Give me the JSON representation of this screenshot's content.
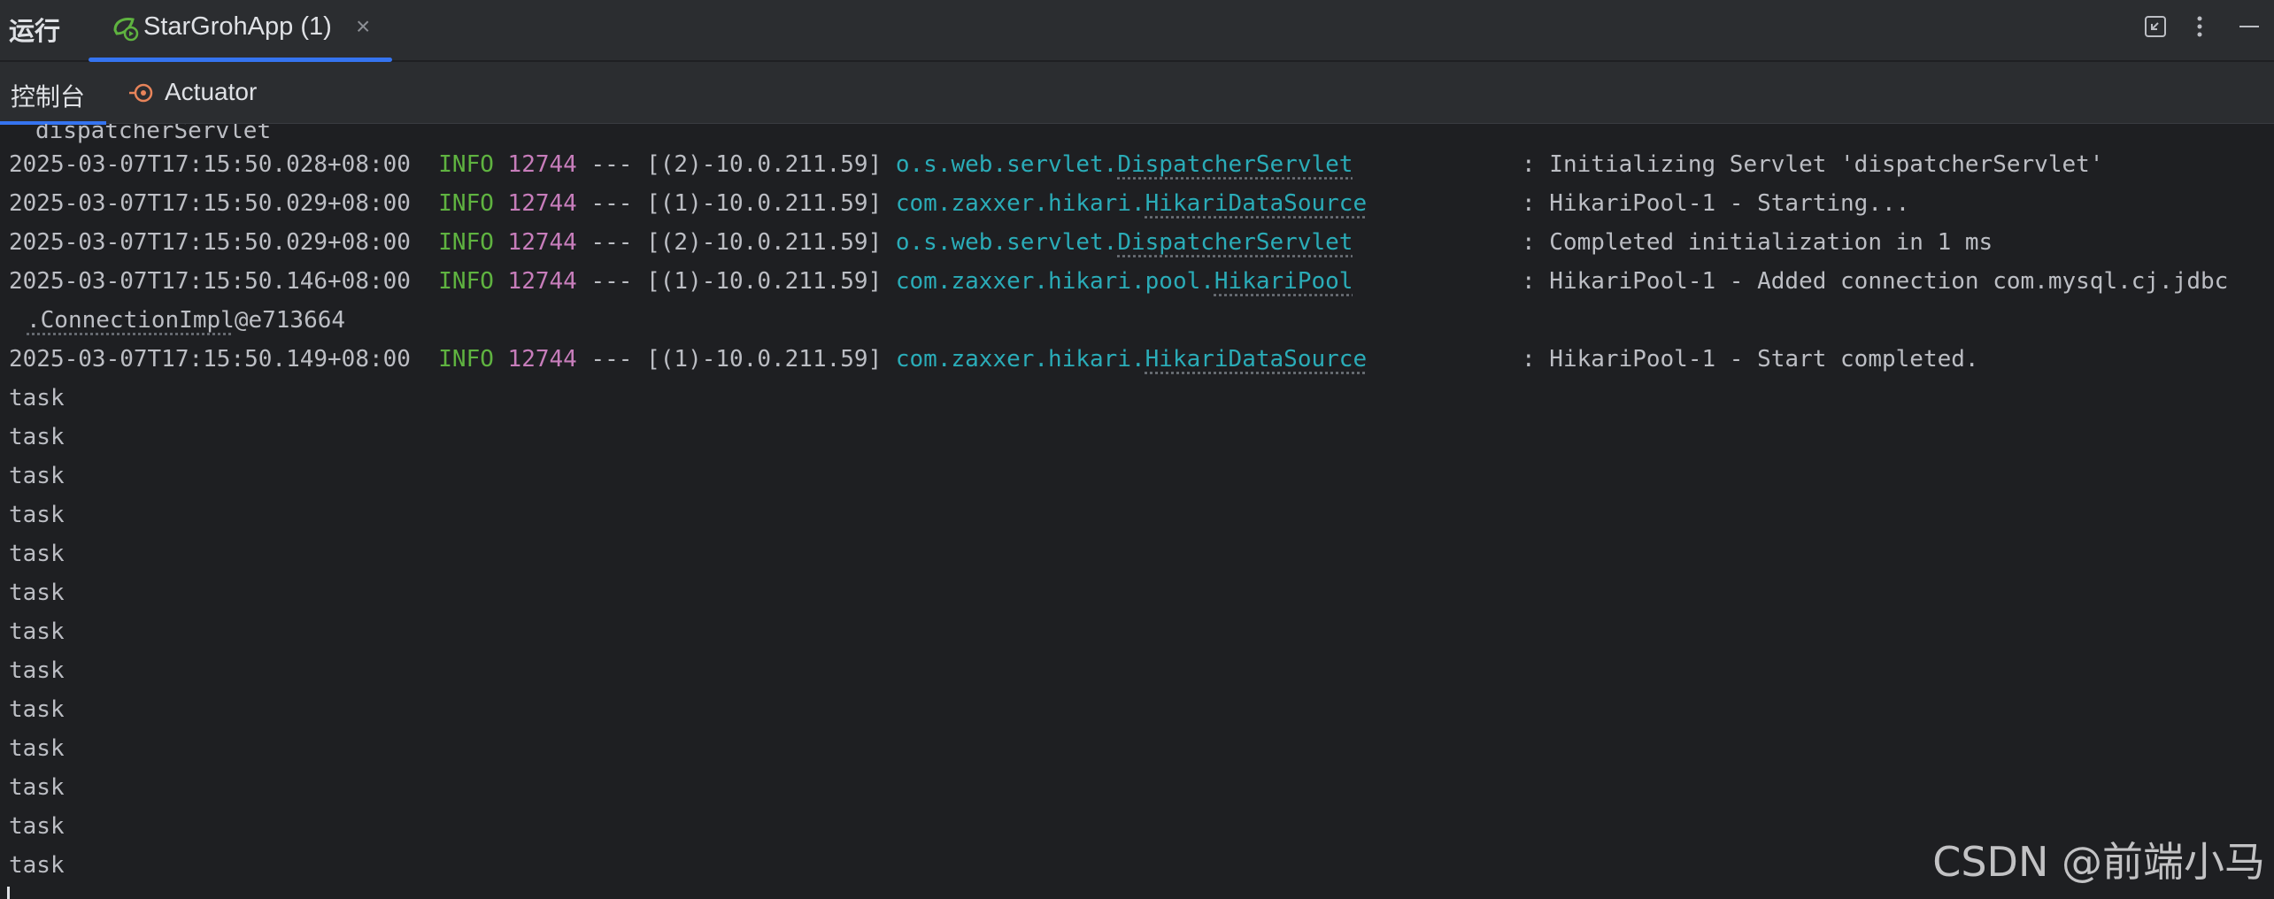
{
  "header": {
    "run_label": "运行",
    "tab_label": "StarGrohApp (1)",
    "tab_close": "×",
    "accent": "#3574f0"
  },
  "subtabs": [
    {
      "label": "控制台",
      "icon": "console"
    },
    {
      "label": "Actuator",
      "icon": "actuator-icon"
    }
  ],
  "console": {
    "truncated_prev": "dispatcherServlet",
    "logs": [
      {
        "ts": "2025-03-07T17:15:50.028+08:00",
        "level": "INFO",
        "pid": "12744",
        "sep": "---",
        "thread": "[(2)-10.0.211.59]",
        "logger_pkg": "o.s.web.servlet.",
        "logger_cls": "DispatcherServlet",
        "message": ": Initializing Servlet 'dispatcherServlet'"
      },
      {
        "ts": "2025-03-07T17:15:50.029+08:00",
        "level": "INFO",
        "pid": "12744",
        "sep": "---",
        "thread": "[(1)-10.0.211.59]",
        "logger_pkg": "com.zaxxer.hikari.",
        "logger_cls": "HikariDataSource",
        "message": ": HikariPool-1 - Starting..."
      },
      {
        "ts": "2025-03-07T17:15:50.029+08:00",
        "level": "INFO",
        "pid": "12744",
        "sep": "---",
        "thread": "[(2)-10.0.211.59]",
        "logger_pkg": "o.s.web.servlet.",
        "logger_cls": "DispatcherServlet",
        "message": ": Completed initialization in 1 ms"
      },
      {
        "ts": "2025-03-07T17:15:50.146+08:00",
        "level": "INFO",
        "pid": "12744",
        "sep": "---",
        "thread": "[(1)-10.0.211.59]",
        "logger_pkg": "com.zaxxer.hikari.pool.",
        "logger_cls": "HikariPool",
        "message": ": HikariPool-1 - Added connection com.mysql.cj.jdbc"
      },
      {
        "ts": "2025-03-07T17:15:50.149+08:00",
        "level": "INFO",
        "pid": "12744",
        "sep": "---",
        "thread": "[(1)-10.0.211.59]",
        "logger_pkg": "com.zaxxer.hikari.",
        "logger_cls": "HikariDataSource",
        "message": ": HikariPool-1 - Start completed."
      }
    ],
    "wrap_line_cls": ".ConnectionImpl",
    "wrap_line_rest": "@e713664",
    "task_lines": [
      "task",
      "task",
      "task",
      "task",
      "task",
      "task",
      "task",
      "task",
      "task",
      "task",
      "task",
      "task",
      "task"
    ]
  },
  "watermark": "CSDN @前端小马"
}
